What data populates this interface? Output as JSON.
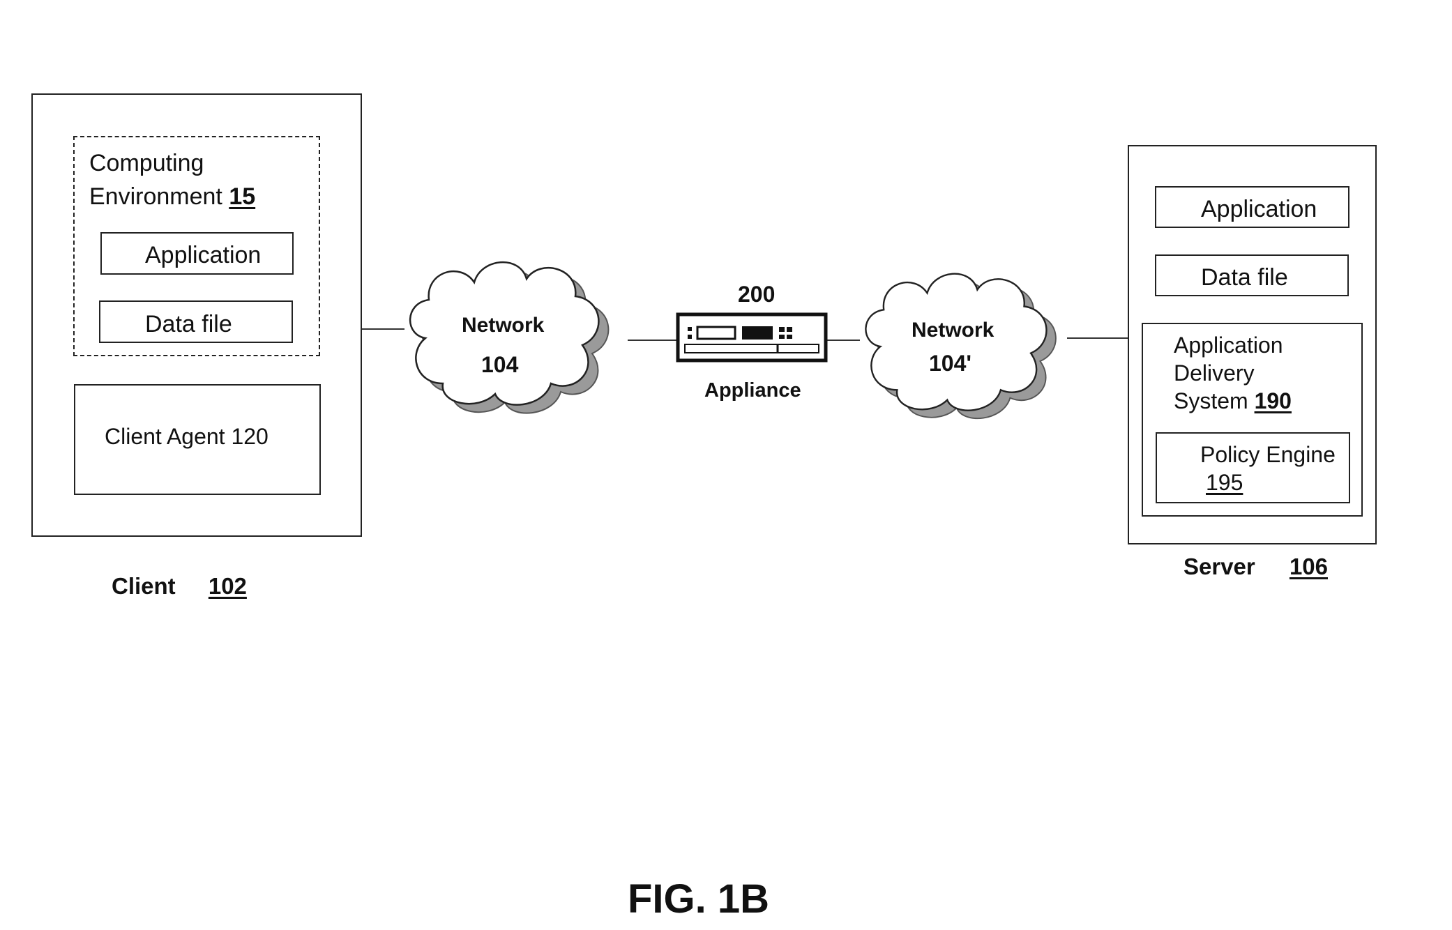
{
  "figure": {
    "title": "FIG. 1B"
  },
  "client": {
    "label": "Client",
    "ref": "102",
    "computing_environment": {
      "label": "Computing",
      "label_line2": "Environment",
      "ref": "15"
    },
    "application_label": "Application",
    "data_file_label": "Data file",
    "client_agent_label": "Client Agent 120"
  },
  "network_left": {
    "label": "Network",
    "ref": "104"
  },
  "appliance": {
    "ref": "200",
    "label": "Appliance"
  },
  "network_right": {
    "label": "Network",
    "ref": "104'"
  },
  "server": {
    "label": "Server",
    "ref": "106",
    "application_label": "Application",
    "data_file_label": "Data file",
    "delivery_system": {
      "line1": "Application",
      "line2": "Delivery",
      "line3": "System",
      "ref": "190"
    },
    "policy_engine": {
      "label": "Policy Engine",
      "ref": "195"
    }
  }
}
